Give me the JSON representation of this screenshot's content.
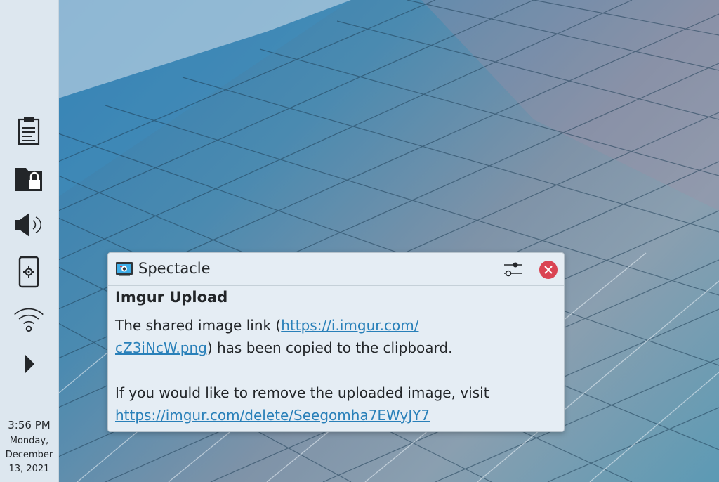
{
  "panel": {
    "tray_icons": [
      "clipboard-icon",
      "vault-icon",
      "volume-icon",
      "kde-connect-icon",
      "wifi-icon",
      "expand-arrow-icon"
    ],
    "clock": {
      "time": "3:56 PM",
      "date_line1": "Monday,",
      "date_line2": "December",
      "date_line3": "13, 2021"
    }
  },
  "notification": {
    "app_name": "Spectacle",
    "title": "Imgur Upload",
    "body": {
      "line1_prefix": "The shared image link (",
      "link1_part1": "https://i.imgur.com/",
      "link1_part2": "cZ3iNcW.png",
      "line2_suffix": ") has been copied to the clipboard.",
      "line3": "If you would like to remove the uploaded image, visit",
      "link2": "https://imgur.com/delete/Seegomha7EWyJY7"
    },
    "colors": {
      "close_button": "#da4453",
      "link": "#2980b9"
    }
  }
}
